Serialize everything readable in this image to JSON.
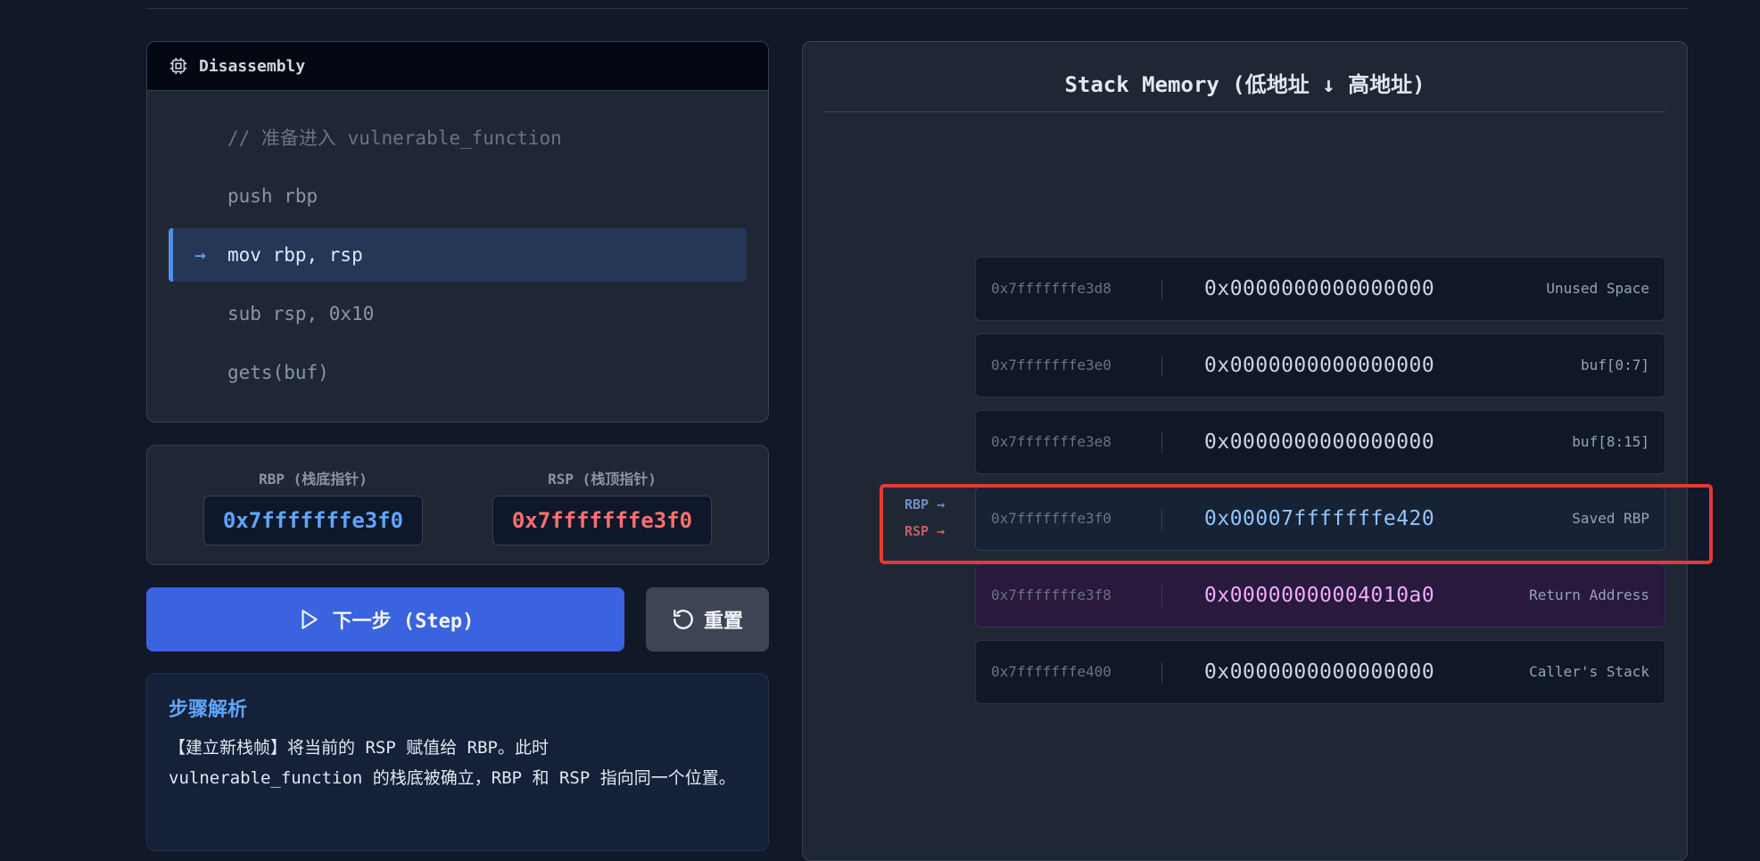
{
  "disassembly": {
    "title": "Disassembly",
    "lines": [
      {
        "text": "// 准备进入 vulnerable_function",
        "active": false
      },
      {
        "text": "push rbp",
        "active": false
      },
      {
        "text": "mov rbp, rsp",
        "active": true
      },
      {
        "text": "sub rsp, 0x10",
        "active": false
      },
      {
        "text": "gets(buf)",
        "active": false
      }
    ],
    "active_marker": "→"
  },
  "registers": {
    "rbp": {
      "label": "RBP (栈底指针)",
      "value": "0x7fffffffe3f0",
      "color": "#60a5fa"
    },
    "rsp": {
      "label": "RSP (栈顶指针)",
      "value": "0x7fffffffe3f0",
      "color": "#f87171"
    }
  },
  "buttons": {
    "step_label": "下一步 (Step)",
    "reset_label": "重置"
  },
  "explanation": {
    "title": "步骤解析",
    "text": "【建立新栈帧】将当前的 RSP 赋值给 RBP。此时 vulnerable_function 的栈底被确立，RBP 和 RSP 指向同一个位置。"
  },
  "stack": {
    "title": "Stack Memory (低地址 ↓ 高地址)",
    "slots": [
      {
        "address": "0x7fffffffe3d8",
        "value": "0x0000000000000000",
        "label": "Unused Space"
      },
      {
        "address": "0x7fffffffe3e0",
        "value": "0x0000000000000000",
        "label": "buf[0:7]"
      },
      {
        "address": "0x7fffffffe3e8",
        "value": "0x0000000000000000",
        "label": "buf[8:15]"
      },
      {
        "address": "0x7fffffffe3f0",
        "value": "0x00007fffffffe420",
        "label": "Saved RBP"
      },
      {
        "address": "0x7fffffffe3f8",
        "value": "0x00000000004010a0",
        "label": "Return Address"
      },
      {
        "address": "0x7fffffffe400",
        "value": "0x0000000000000000",
        "label": "Caller's Stack"
      }
    ],
    "pointers": {
      "rbp": "RBP →",
      "rsp": "RSP →"
    },
    "highlight_color": "#e53935"
  }
}
